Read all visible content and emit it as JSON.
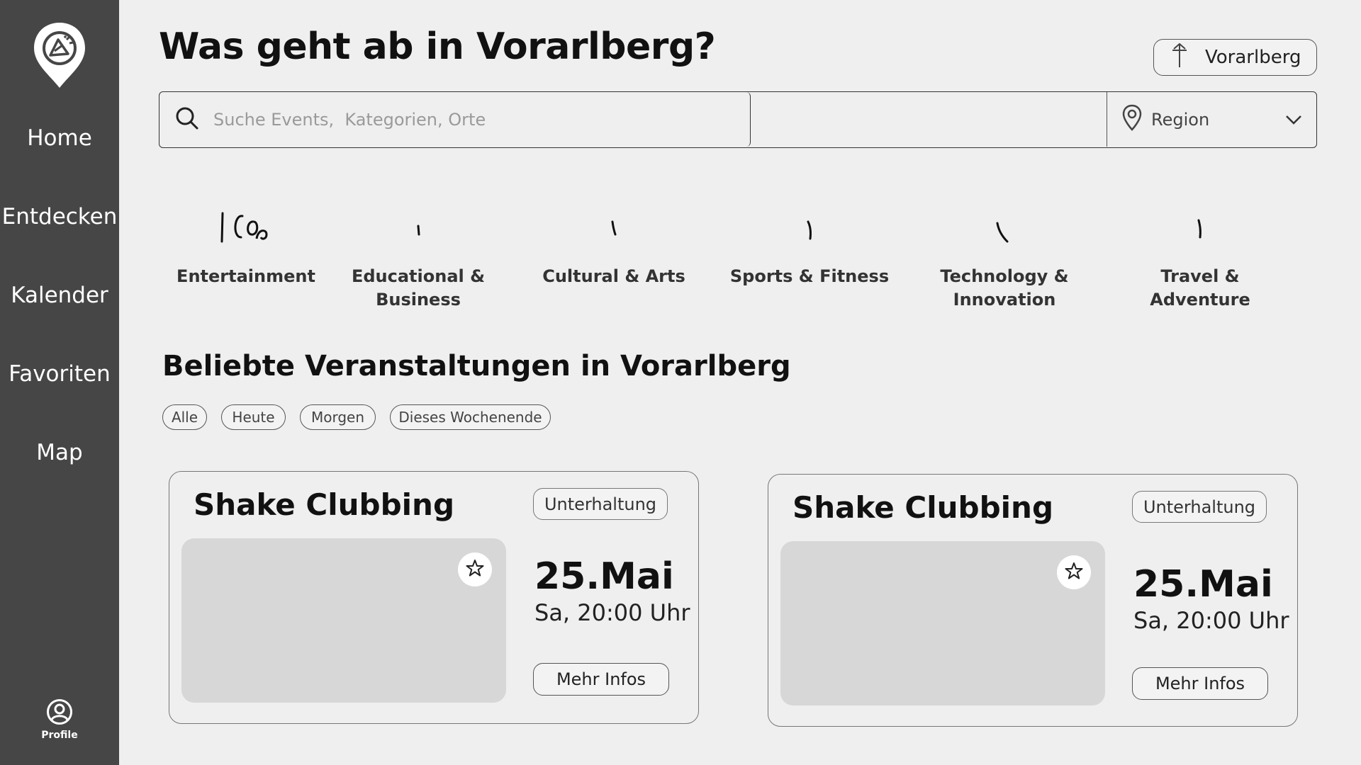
{
  "sidebar": {
    "items": [
      {
        "label": "Home"
      },
      {
        "label": "Entdecken"
      },
      {
        "label": "Kalender"
      },
      {
        "label": "Favoriten"
      },
      {
        "label": "Map"
      }
    ],
    "profile_label": "Profile",
    "background": "#464646"
  },
  "header": {
    "title": "Was geht ab in Vorarlberg?",
    "region_chip_label": "Vorarlberg"
  },
  "search": {
    "placeholder": "Suche Events,  Kategorien, Orte",
    "value": "",
    "region_label": "Region"
  },
  "categories": [
    {
      "label": "Entertainment",
      "icon": "icon-placeholder-sketch"
    },
    {
      "label": "Educational & Business",
      "icon": "icon-placeholder-sketch"
    },
    {
      "label": "Cultural & Arts",
      "icon": "icon-placeholder-sketch"
    },
    {
      "label": "Sports & Fitness",
      "icon": "icon-placeholder-sketch"
    },
    {
      "label": "Technology & Innovation",
      "icon": "icon-placeholder-sketch"
    },
    {
      "label": "Travel & Adventure",
      "icon": "icon-placeholder-sketch"
    }
  ],
  "section": {
    "title": "Beliebte Veranstaltungen in Vorarlberg",
    "filters": [
      "Alle",
      "Heute",
      "Morgen",
      "Dieses Wochenende"
    ]
  },
  "events": [
    {
      "title": "Shake Clubbing",
      "tag": "Unterhaltung",
      "date": "25.Mai",
      "time": "Sa, 20:00 Uhr",
      "button": "Mehr Infos",
      "favorite_icon": "star-outline-icon"
    },
    {
      "title": "Shake Clubbing",
      "tag": "Unterhaltung",
      "date": "25.Mai",
      "time": "Sa, 20:00 Uhr",
      "button": "Mehr Infos",
      "favorite_icon": "star-outline-icon"
    }
  ]
}
